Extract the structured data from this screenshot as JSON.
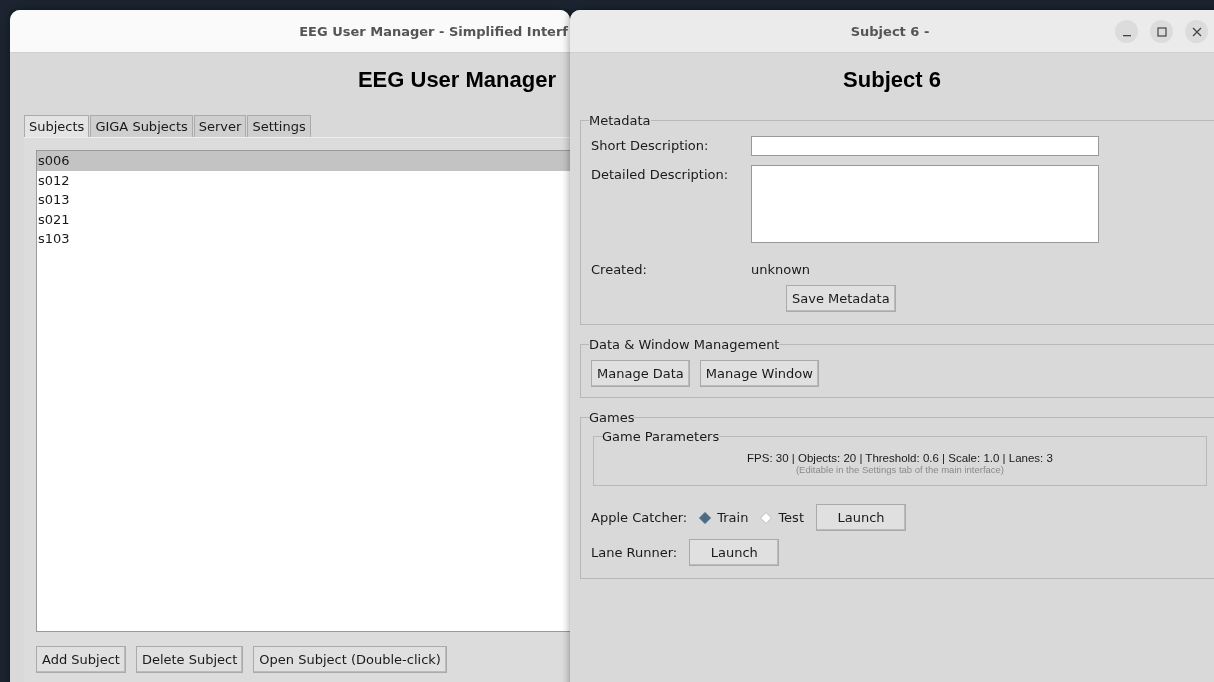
{
  "main_window": {
    "title": "EEG User Manager - Simplified Interf",
    "heading": "EEG User Manager",
    "tabs": [
      {
        "label": "Subjects",
        "selected": true
      },
      {
        "label": "GIGA Subjects",
        "selected": false
      },
      {
        "label": "Server",
        "selected": false
      },
      {
        "label": "Settings",
        "selected": false
      }
    ],
    "subjects": [
      {
        "label": "s006",
        "selected": true
      },
      {
        "label": "s012",
        "selected": false
      },
      {
        "label": "s013",
        "selected": false
      },
      {
        "label": "s021",
        "selected": false
      },
      {
        "label": "s103",
        "selected": false
      }
    ],
    "buttons": [
      "Add Subject",
      "Delete Subject",
      "Open Subject (Double-click)"
    ]
  },
  "dialog": {
    "title": "Subject 6 -",
    "heading": "Subject 6",
    "metadata": {
      "title": "Metadata",
      "short_label": "Short Description:",
      "detailed_label": "Detailed Description:",
      "created_label": "Created:",
      "created_value": "unknown",
      "save_button": "Save Metadata"
    },
    "management": {
      "title": "Data & Window Management",
      "buttons": [
        "Manage Data",
        "Manage Window"
      ]
    },
    "games": {
      "title": "Games",
      "parameters": {
        "title": "Game Parameters",
        "summary": "FPS: 30 | Objects: 20 | Threshold: 0.6 | Scale: 1.0 | Lanes: 3",
        "note": "(Editable in the Settings tab of the main interface)"
      },
      "apple_catcher": {
        "label": "Apple Catcher:",
        "modes": [
          {
            "label": "Train",
            "selected": true
          },
          {
            "label": "Test",
            "selected": false
          }
        ],
        "button": "Launch"
      },
      "lane_runner": {
        "label": "Lane Runner:",
        "button": "Launch"
      }
    }
  }
}
